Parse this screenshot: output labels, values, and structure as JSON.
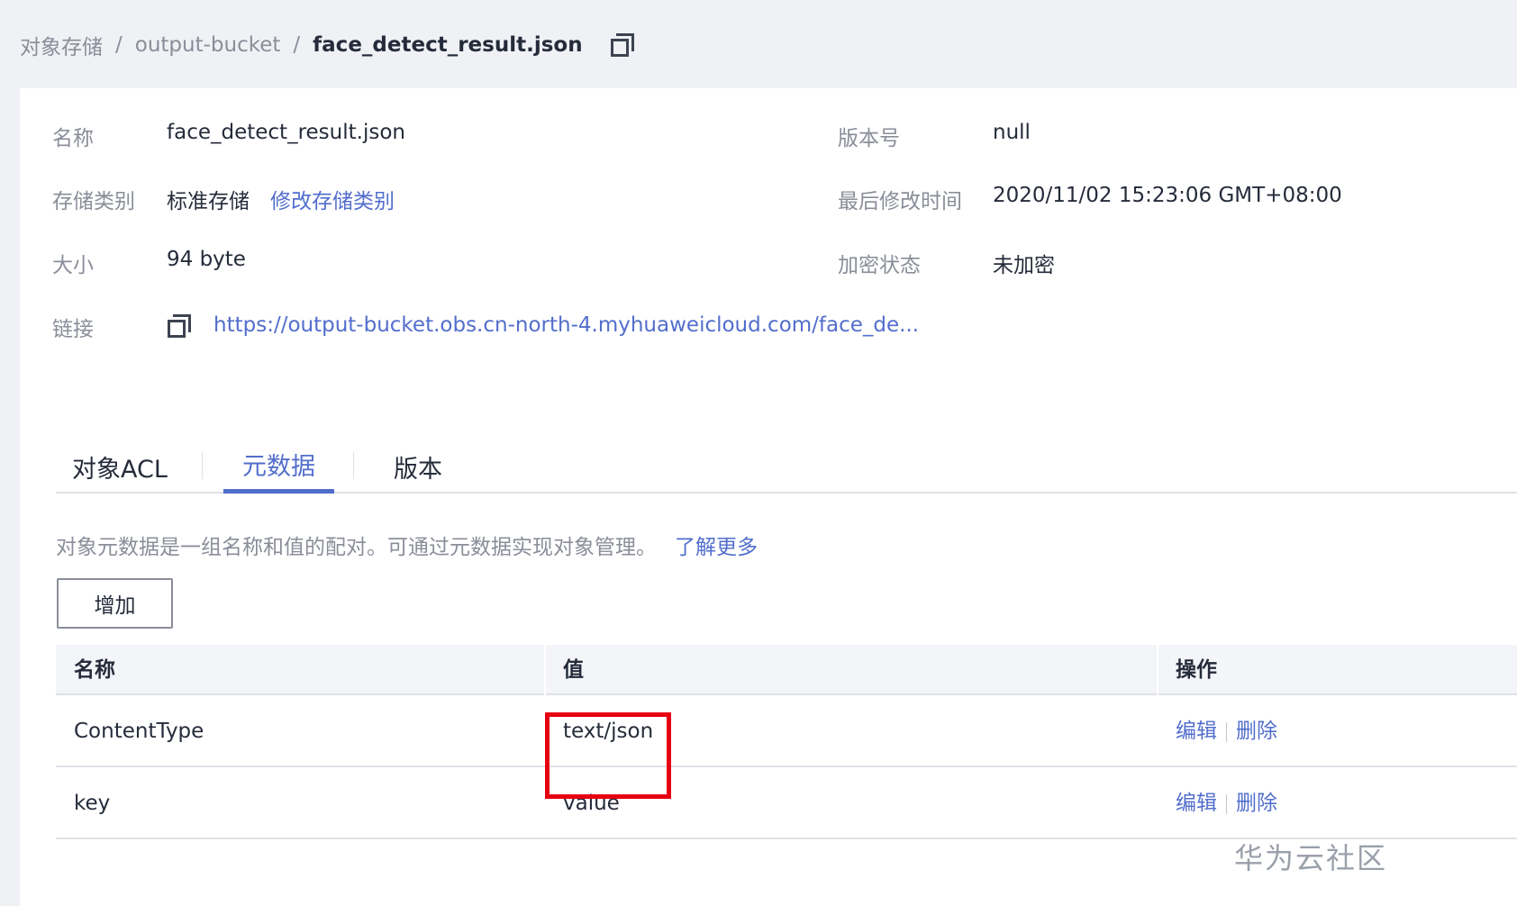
{
  "breadcrumb": {
    "root": "对象存储",
    "bucket": "output-bucket",
    "current": "face_detect_result.json"
  },
  "info": {
    "name_label": "名称",
    "name_value": "face_detect_result.json",
    "storage_label": "存储类别",
    "storage_value": "标准存储",
    "storage_change": "修改存储类别",
    "size_label": "大小",
    "size_value": "94 byte",
    "link_label": "链接",
    "link_value": "https://output-bucket.obs.cn-north-4.myhuaweicloud.com/face_de...",
    "version_label": "版本号",
    "version_value": "null",
    "modified_label": "最后修改时间",
    "modified_value": "2020/11/02 15:23:06 GMT+08:00",
    "encrypt_label": "加密状态",
    "encrypt_value": "未加密"
  },
  "tabs": [
    {
      "label": "对象ACL",
      "active": false
    },
    {
      "label": "元数据",
      "active": true
    },
    {
      "label": "版本",
      "active": false
    }
  ],
  "metadata": {
    "description": "对象元数据是一组名称和值的配对。可通过元数据实现对象管理。",
    "learn_more": "了解更多",
    "add_button": "增加",
    "columns": [
      "名称",
      "值",
      "操作"
    ],
    "rows": [
      {
        "name": "ContentType",
        "value": "text/json",
        "edit": "编辑",
        "delete": "删除"
      },
      {
        "name": "key",
        "value": "value",
        "edit": "编辑",
        "delete": "删除"
      }
    ]
  },
  "watermark": "华为云社区",
  "colors": {
    "accent": "#526ecc",
    "highlight": "#e60012"
  },
  "icons": [
    "copy-icon"
  ]
}
